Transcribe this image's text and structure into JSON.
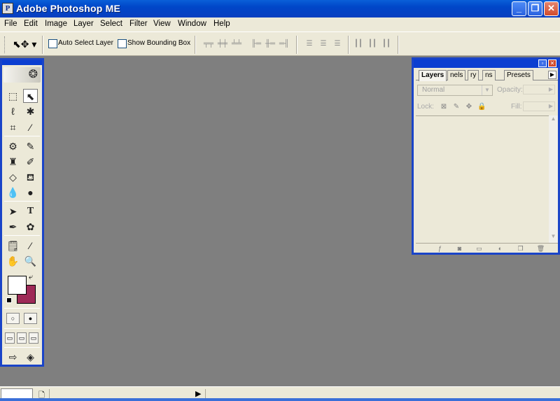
{
  "window": {
    "title": "Adobe Photoshop ME",
    "app_icon": "photoshop-app-icon",
    "controls": {
      "minimize": "_",
      "maximize": "❐",
      "close": "✕"
    }
  },
  "menu": [
    "File",
    "Edit",
    "Image",
    "Layer",
    "Select",
    "Filter",
    "View",
    "Window",
    "Help"
  ],
  "options_bar": {
    "tool_icon": "move-tool-icon",
    "auto_select_label": "Auto Select Layer",
    "show_bounding_box_label": "Show Bounding Box"
  },
  "toolbox": {
    "foreground_color": "#ffffff",
    "background_color": "#9e2a57"
  },
  "layers_palette": {
    "tabs": [
      "Layers",
      "nels",
      "ry",
      "ns",
      "Presets"
    ],
    "active_tab": "Layers",
    "blend_mode": "Normal",
    "opacity_label": "Opacity:",
    "lock_label": "Lock:",
    "fill_label": "Fill:"
  },
  "colors": {
    "titlebar": "#0046c8",
    "chrome": "#ece9d8",
    "workspace": "#7f7f7f",
    "palette_border": "#1a44c8"
  }
}
